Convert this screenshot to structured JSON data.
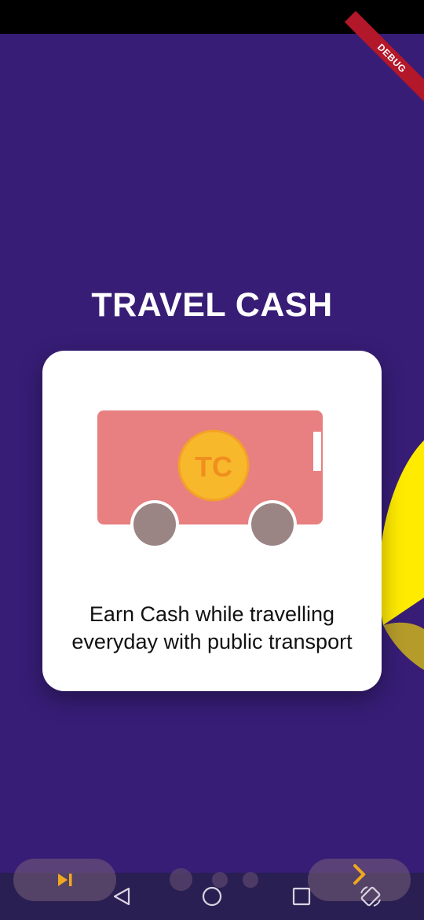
{
  "debug_banner": "DEBUG",
  "title": "TRAVEL CASH",
  "card": {
    "coin_text": "TC",
    "description": "Earn Cash while travelling everyday with public transport"
  },
  "onboarding": {
    "page_count": 3,
    "current_page": 1
  },
  "colors": {
    "background": "#371d76",
    "bus_body": "#e87f80",
    "wheel": "#9b8584",
    "coin_fill": "#f8b82c",
    "coin_text": "#f08f1e",
    "decor_yellow": "#ffeb00",
    "button_accent": "#f0a820"
  },
  "icons": {
    "skip": "skip-next-icon",
    "next": "chevron-right-icon",
    "back": "back-triangle-icon",
    "home": "home-circle-icon",
    "recents": "recents-square-icon",
    "rotate": "rotate-screen-icon"
  }
}
